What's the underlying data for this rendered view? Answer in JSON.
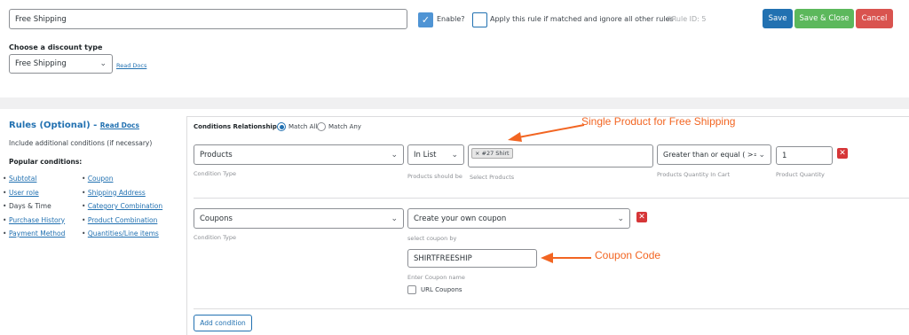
{
  "header": {
    "rule_name": "Free Shipping",
    "enable_label": "Enable?",
    "apply_label": "Apply this rule if matched and ignore all other rules",
    "rule_id": "#Rule ID: 5",
    "save": "Save",
    "save_close": "Save & Close",
    "cancel": "Cancel"
  },
  "discount": {
    "label": "Choose a discount type",
    "value": "Free Shipping",
    "read_docs": "Read Docs"
  },
  "rules_panel": {
    "title": "Rules (Optional) -",
    "read_docs": "Read Docs",
    "subtitle": "Include additional conditions (if necessary)",
    "popular": "Popular conditions:",
    "col1": [
      "Subtotal",
      "User role",
      "Days & Time",
      "Purchase History",
      "Payment Method"
    ],
    "col2": [
      "Coupon",
      "Shipping Address",
      "Category Combination",
      "Product Combination",
      "Quantities/Line items"
    ]
  },
  "conditions": {
    "relationship_label": "Conditions Relationship",
    "match_all": "Match All",
    "match_any": "Match Any",
    "row1": {
      "type": "Products",
      "type_hint": "Condition Type",
      "operator": "In List",
      "operator_hint": "Products should be",
      "product_tag": "× #27 Shirt",
      "product_hint": "Select Products",
      "qty_op": "Greater than or equal ( >= )",
      "qty_op_hint": "Products Quantity In Cart",
      "qty": "1",
      "qty_hint": "Product Quantity"
    },
    "row2": {
      "type": "Coupons",
      "type_hint": "Condition Type",
      "coupon_select": "Create your own coupon",
      "coupon_select_hint": "select coupon by",
      "coupon_name": "SHIRTFREESHIP",
      "coupon_name_hint": "Enter Coupon name",
      "url_coupons": "URL Coupons"
    },
    "add_condition": "Add condition"
  },
  "annotations": {
    "single_product": "Single Product for Free Shipping",
    "coupon_code": "Coupon Code"
  },
  "colors": {
    "save": "#2271b1",
    "save_close": "#5cb85c",
    "cancel": "#d9534f",
    "annotation": "#f26522"
  }
}
